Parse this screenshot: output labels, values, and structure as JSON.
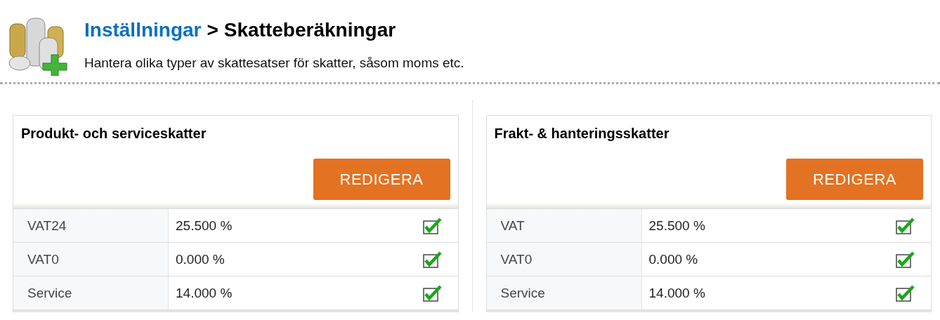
{
  "breadcrumb": {
    "parent": "Inställningar",
    "separator": ">",
    "current": "Skatteberäkningar"
  },
  "description": "Hantera olika typer av skattesatser för skatter, såsom moms etc.",
  "panels": [
    {
      "title": "Produkt- och serviceskatter",
      "button": "REDIGERA",
      "rows": [
        {
          "name": "VAT24",
          "rate": "25.500 %",
          "checked": true
        },
        {
          "name": "VAT0",
          "rate": "0.000 %",
          "checked": true
        },
        {
          "name": "Service",
          "rate": "14.000 %",
          "checked": true
        }
      ]
    },
    {
      "title": "Frakt- & hanteringsskatter",
      "button": "REDIGERA",
      "rows": [
        {
          "name": "VAT",
          "rate": "25.500 %",
          "checked": true
        },
        {
          "name": "VAT0",
          "rate": "0.000 %",
          "checked": true
        },
        {
          "name": "Service",
          "rate": "14.000 %",
          "checked": true
        }
      ]
    }
  ]
}
